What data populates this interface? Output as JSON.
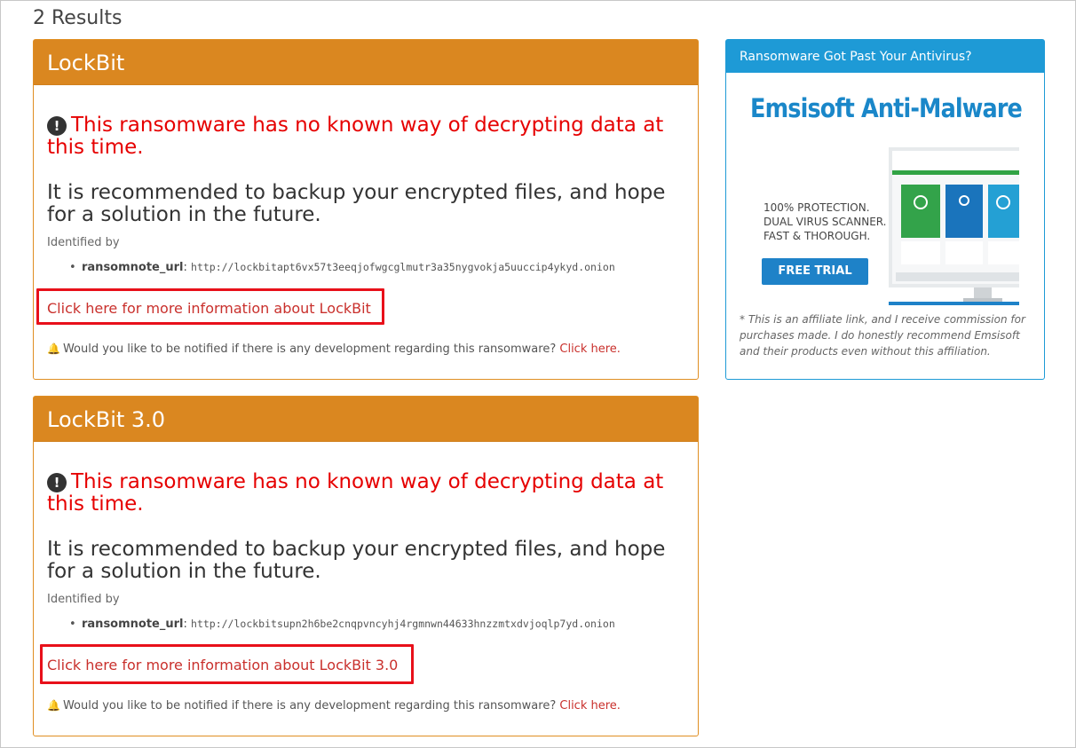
{
  "results_count": "2 Results",
  "cards": [
    {
      "title": "LockBit",
      "warning": "This ransomware has no known way of decrypting data at this time.",
      "recommendation": "It is recommended to backup your encrypted files, and hope for a solution in the future.",
      "identified_by_label": "Identified by",
      "ident_key": "ransomnote_url",
      "ident_value": "http://lockbitapt6vx57t3eeqjofwgcglmutr3a35nygvokja5uuccip4ykyd.onion",
      "more_info": "Click here for more information about LockBit",
      "notify_text": "Would you like to be notified if there is any development regarding this ransomware?",
      "notify_link": "Click here."
    },
    {
      "title": "LockBit 3.0",
      "warning": "This ransomware has no known way of decrypting data at this time.",
      "recommendation": "It is recommended to backup your encrypted files, and hope for a solution in the future.",
      "identified_by_label": "Identified by",
      "ident_key": "ransomnote_url",
      "ident_value": "http://lockbitsupn2h6be2cnqpvncyhj4rgmnwn44633hnzzmtxdvjoqlp7yd.onion",
      "more_info": "Click here for more information about LockBit 3.0",
      "notify_text": "Would you like to be notified if there is any development regarding this ransomware?",
      "notify_link": "Click here."
    }
  ],
  "ad": {
    "header": "Ransomware Got Past Your Antivirus?",
    "title": "Emsisoft Anti-Malware",
    "line1": "100% PROTECTION.",
    "line2": "DUAL VIRUS SCANNER.",
    "line3": "FAST & THOROUGH.",
    "button": "FREE TRIAL",
    "footnote": "* This is an affiliate link, and I receive commission for purchases made. I do honestly recommend Emsisoft and their products even without this affiliation."
  },
  "colors": {
    "card_header": "#da8720",
    "warning_red": "#e60000",
    "link_red": "#c9302c",
    "highlight_box": "#e8101a",
    "ad_blue": "#1e9ad6"
  }
}
